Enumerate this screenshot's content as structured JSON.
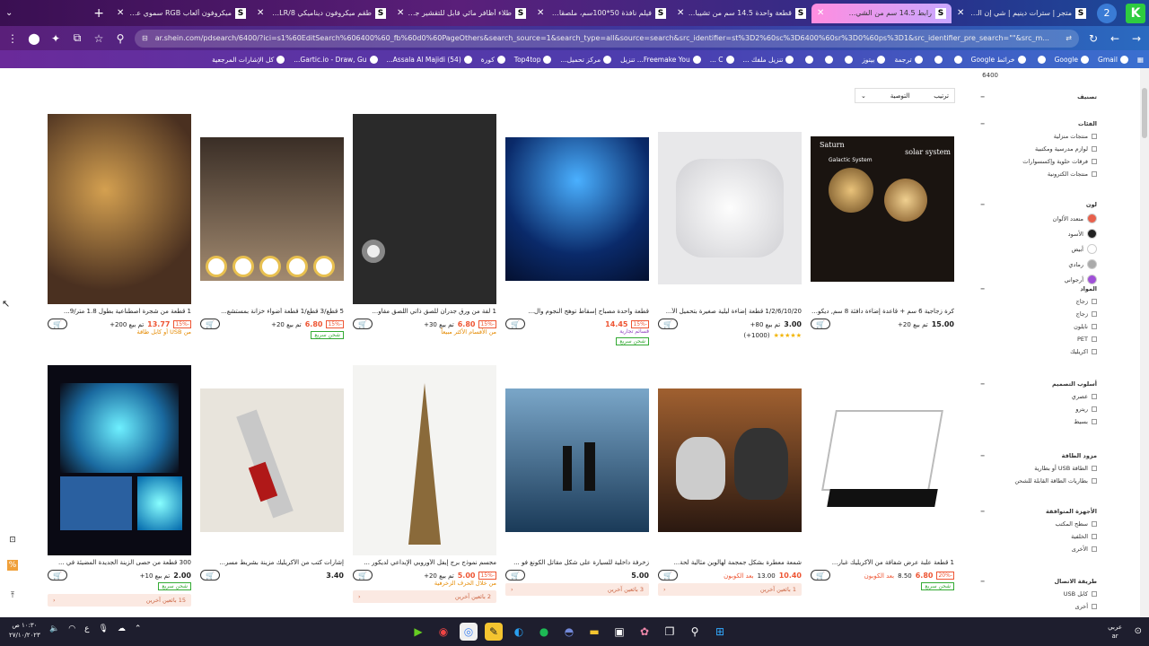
{
  "tabs": [
    {
      "title": "متجر | سترات دينيم | شي إن الكو...",
      "fav": "S",
      "active": false
    },
    {
      "title": "رابط 14.5 سم من الشي...",
      "fav": "S",
      "active": true
    },
    {
      "title": "قطعة واحدة 14.5 سم من تشيبا...",
      "fav": "S",
      "active": false
    },
    {
      "title": "فيلم نافذة 50*100سم، ملصقات ...",
      "fav": "S",
      "active": false
    },
    {
      "title": "طلاء أظافر مائي قابل للتقشير جد...",
      "fav": "S",
      "active": false
    },
    {
      "title": "طقم ميكروفون ديناميكي 8/XLR ...",
      "fav": "S",
      "active": false
    },
    {
      "title": "ميكروفون ألعاب RGB سموي علي...",
      "fav": "S",
      "active": false
    }
  ],
  "new_tab": "+",
  "browser": {
    "logo": "K",
    "profile": "2",
    "url": "ar.shein.com/pdsearch/6400/?ici=s1%60EditSearch%606400%60_fb%60d0%60PageOthers&search_source=1&search_type=all&source=search&src_identifier=st%3D2%60sc%3D6400%60sr%3D0%60ps%3D1&src_identifier_pre_search=\"\"&src_m..."
  },
  "bookmarks": [
    "Gmail",
    "Google",
    "",
    "خرائط Google",
    "",
    "",
    "ترجمة",
    "بيتوز",
    "",
    "",
    "",
    "تنزيل ملفك ...",
    "C ...",
    "Freemake You... تنزيل",
    "مركز تحميل...",
    "Top4top",
    "كورة",
    "(54) Assala Al Majidi...",
    "Gartic.io - Draw, Gu...",
    "كل الإشارات المرجعية"
  ],
  "sort": {
    "label": "التوصية",
    "prefix": "ترتيب"
  },
  "search_count": "6400",
  "sidebar": {
    "sort_title": "تصنيف",
    "cat_title": "الفئات",
    "categories": [
      "منتجات منزلية",
      "لوازم مدرسية ومكتبية",
      "فرقات حلوية وإكسسوارات",
      "منتجات الكترونية"
    ],
    "color_title": "لون",
    "colors": [
      {
        "name": "متعدد الألوان",
        "hex": "#e8604c"
      },
      {
        "name": "الأسود",
        "hex": "#222222"
      },
      {
        "name": "أبيض",
        "hex": "#ffffff"
      },
      {
        "name": "رمادي",
        "hex": "#aaaaaa"
      },
      {
        "name": "أرجواني",
        "hex": "#a050d8"
      }
    ],
    "material_title": "المواد",
    "materials": [
      "زجاج",
      "زجاج",
      "نايلون",
      "PET",
      "اكريليك"
    ],
    "style_title": "أسلوب التصميم",
    "styles": [
      "عصري",
      "ريترو",
      "بسيط"
    ],
    "power_title": "مزود الطاقة",
    "power": [
      "الطاقة USB أو بطارية",
      "بطاريات الطاقة القابلة للشحن"
    ],
    "device_title": "الأجهزة المتوافقة",
    "devices": [
      "سطح المكتب",
      "الخلفية",
      "الأخرى"
    ],
    "conn_title": "طريقة الاتصال",
    "conn": [
      "كابل USB",
      "أخرى"
    ]
  },
  "products_row1": [
    {
      "title": "كرة زجاجية 6 سم + قاعدة إضاءة دافئة 8 سم, ديكور ...",
      "price": "15.00",
      "sold": "تم بيع 20+",
      "img": "crystal"
    },
    {
      "title": "1/2/6/10/20 قطعة إضاءة ليلية صغيرة بتحميل الأ...",
      "price": "3.00",
      "sold": "تم بيع 80+",
      "rating": "(1000+)",
      "img": "usb"
    },
    {
      "title": "قطعة واحدة مصباح إسقاط توهج النجوم وال...",
      "price": "14.45",
      "badge": "قسائم تجارية",
      "disc": "-15%",
      "ship": "شحن سريع",
      "img": "galaxy"
    },
    {
      "title": "1 لفة من ورق جدران للصق ذاتي اللصق مقاو...",
      "price": "6.80",
      "sold": "تم بيع 30+",
      "disc": "-15%",
      "promo": "من الأقسام الأكثر مبيعاً",
      "img": "roll"
    },
    {
      "title": "5 قطع/3 قطع/1 قطعة أضواء خزانة بمستشع...",
      "price": "6.80",
      "sold": "تم بيع 20+",
      "disc": "-15%",
      "ship": "شحن سريع",
      "img": "cabinet"
    },
    {
      "title": "1 قطعة من شجرة اصطناعية بطول 1.8 متر/9...",
      "price": "13.77",
      "sold": "تم بيع 200+",
      "disc": "-15%",
      "promo": "من USB أو كابل طاقة",
      "img": "tree"
    }
  ],
  "products_row2": [
    {
      "title": "1 قطعة علبة عرض شفافة من الأكريليك غبار...",
      "price": "6.80",
      "old": "8.50",
      "coupon": "بعد الكوبون",
      "disc": "-20%",
      "ship": "شحن سريع",
      "img": "acrylic"
    },
    {
      "title": "شمعة معطرة بشكل جمجمة لهالوين مثالية لحة...",
      "price": "10.40",
      "old": "13.00",
      "coupon": "بعد الكوبون",
      "strip": "1 بائعين آخرين",
      "img": "skull"
    },
    {
      "title": "زخرفة داخلية للسيارة على شكل مقاتل الكونغ فو ...",
      "price": "5.00",
      "strip": "3 بائعين آخرين",
      "img": "car"
    },
    {
      "title": "مجسم نموذج برج إيفل الأوروبي الإبداعي لديكور ...",
      "price": "5.00",
      "sold": "تم بيع 20+",
      "disc": "-15%",
      "promo": "من خلال الحرف الزخرفية",
      "strip": "2 بائعين آخرين",
      "img": "eiffel"
    },
    {
      "title": "إشارات كتب من الأكريليك مزينة بشريط مسر...",
      "price": "3.40",
      "img": "book"
    },
    {
      "title": "300 قطعة من حصى الزينة الجديدة المضيئة في ...",
      "price": "2.00",
      "sold": "تم بيع 10+",
      "ship": "شحن سريع",
      "strip": "15 بائعين آخرين",
      "img": "pebbles"
    }
  ],
  "taskbar": {
    "time": "١٠:٣٠ ص",
    "date": "٢٧/١٠/٢٠٢٣",
    "lang": "عربي",
    "lang2": "ar"
  }
}
